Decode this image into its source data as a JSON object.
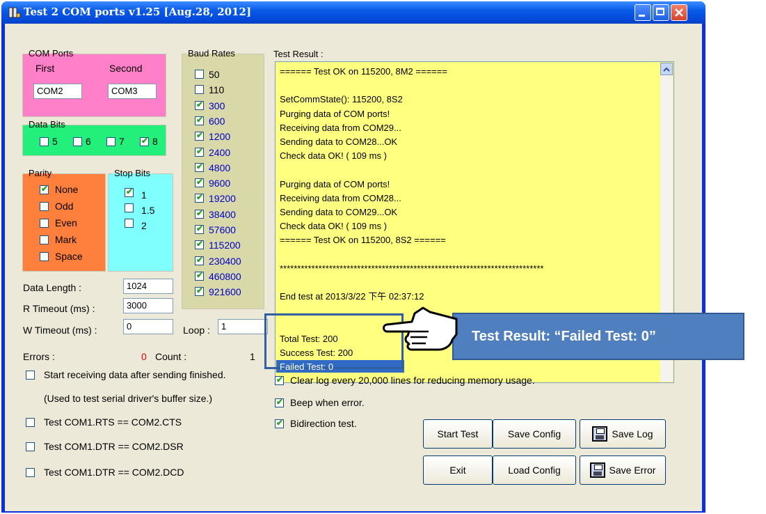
{
  "window": {
    "title": "Test 2 COM ports v1.25 [Aug.28, 2012]"
  },
  "com_ports": {
    "legend": "COM Ports",
    "first_label": "First",
    "second_label": "Second",
    "first_value": "COM2",
    "second_value": "COM3"
  },
  "data_bits": {
    "legend": "Data Bits",
    "options": [
      {
        "label": "5",
        "checked": false
      },
      {
        "label": "6",
        "checked": false
      },
      {
        "label": "7",
        "checked": false
      },
      {
        "label": "8",
        "checked": true
      }
    ]
  },
  "parity": {
    "legend": "Parity",
    "options": [
      {
        "label": "None",
        "checked": true
      },
      {
        "label": "Odd",
        "checked": false
      },
      {
        "label": "Even",
        "checked": false
      },
      {
        "label": "Mark",
        "checked": false
      },
      {
        "label": "Space",
        "checked": false
      }
    ]
  },
  "stop_bits": {
    "legend": "Stop Bits",
    "options": [
      {
        "label": "1",
        "checked": true
      },
      {
        "label": "1.5",
        "checked": false
      },
      {
        "label": "2",
        "checked": false
      }
    ]
  },
  "baud_rates": {
    "legend": "Baud Rates",
    "options": [
      {
        "label": "50",
        "checked": false
      },
      {
        "label": "110",
        "checked": false
      },
      {
        "label": "300",
        "checked": true
      },
      {
        "label": "600",
        "checked": true
      },
      {
        "label": "1200",
        "checked": true
      },
      {
        "label": "2400",
        "checked": true
      },
      {
        "label": "4800",
        "checked": true
      },
      {
        "label": "9600",
        "checked": true
      },
      {
        "label": "19200",
        "checked": true
      },
      {
        "label": "38400",
        "checked": true
      },
      {
        "label": "57600",
        "checked": true
      },
      {
        "label": "115200",
        "checked": true
      },
      {
        "label": "230400",
        "checked": true
      },
      {
        "label": "460800",
        "checked": true
      },
      {
        "label": "921600",
        "checked": true
      }
    ]
  },
  "params": {
    "data_length_label": "Data Length :",
    "data_length": "1024",
    "r_timeout_label": "R Timeout (ms) :",
    "r_timeout": "3000",
    "w_timeout_label": "W Timeout (ms) :",
    "w_timeout": "0",
    "loop_label": "Loop :",
    "loop": "1"
  },
  "status": {
    "errors_label": "Errors :",
    "errors_value": "0",
    "count_label": "Count :",
    "count_value": "1"
  },
  "options_left": [
    {
      "label": "Start receiving data after sending finished.",
      "checked": false
    },
    {
      "note": "(Used to test serial driver's buffer size.)"
    },
    {
      "label": "Test COM1.RTS == COM2.CTS",
      "checked": false
    },
    {
      "label": "Test COM1.DTR == COM2.DSR",
      "checked": false
    },
    {
      "label": "Test COM1.DTR == COM2.DCD",
      "checked": false
    }
  ],
  "options_right": [
    {
      "label": "Clear log every 20,000  lines for reducing memory usage.",
      "checked": true
    },
    {
      "label": "Beep when error.",
      "checked": true
    },
    {
      "label": "Bidirection test.",
      "checked": true
    }
  ],
  "log": {
    "label": "Test Result :",
    "lines": [
      "====== Test OK on 115200, 8M2 ======",
      "",
      "SetCommState(): 115200, 8S2",
      "Purging data of COM ports!",
      "Receiving data from COM29...",
      "Sending data to COM28...OK",
      "Check data OK! ( 109 ms )",
      "",
      "Purging data of COM ports!",
      "Receiving data from COM28...",
      "Sending data to COM29...OK",
      "Check data OK! ( 109 ms )",
      "====== Test OK on 115200, 8S2 ======",
      "",
      "***************************************************************************",
      "",
      "End test at 2013/3/22 下午 02:37:12",
      "",
      "",
      "Total Test: 200",
      "Success Test: 200",
      "Failed Test: 0"
    ]
  },
  "buttons": {
    "start_test": "Start Test",
    "save_config": "Save Config",
    "save_log": "Save Log",
    "exit": "Exit",
    "load_config": "Load Config",
    "save_error": "Save Error"
  },
  "callout": {
    "text": "Test Result: “Failed Test: 0”"
  },
  "colors": {
    "com_ports_bg": "#ff7fc8",
    "data_bits_bg": "#22f07a",
    "parity_bg": "#ff7f3c",
    "stop_bits_bg": "#80ffff",
    "baud_rates_bg": "#d8d8a8",
    "log_bg": "#ffff80",
    "selection": "#316ac5",
    "callout": "#4f7fbf"
  }
}
